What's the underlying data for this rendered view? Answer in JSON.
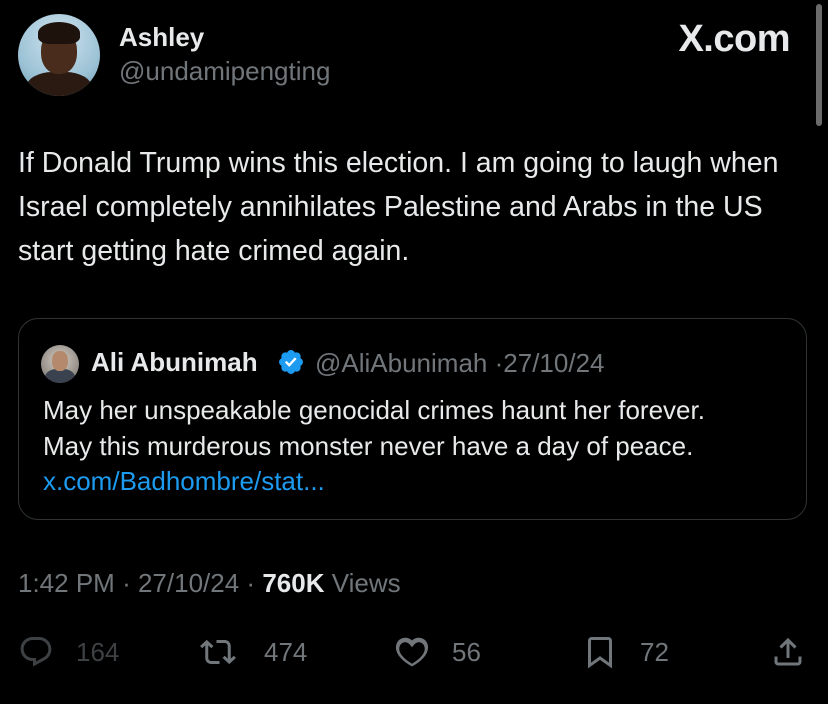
{
  "author": {
    "name": "Ashley",
    "handle": "@undamipengting"
  },
  "brand": "X.com",
  "tweet": {
    "text": "If Donald Trump wins this election. I am going to laugh when Israel completely annihilates Palestine and Arabs in the US start getting hate crimed again."
  },
  "quote": {
    "name": "Ali Abunimah",
    "handle": "@AliAbunimah",
    "date": "27/10/24",
    "line1": "May her unspeakable genocidal crimes haunt her forever.",
    "line2": "May this murderous monster never have a day of peace.",
    "link": "x.com/Badhombre/stat..."
  },
  "meta": {
    "time": "1:42 PM",
    "date": "27/10/24",
    "views_count": "760K",
    "views_label": "Views"
  },
  "actions": {
    "replies": "164",
    "reposts": "474",
    "likes": "56",
    "bookmarks": "72"
  },
  "colors": {
    "background": "#000000",
    "text": "#e7e9ea",
    "secondary": "#71767b",
    "link": "#1d9bf0",
    "verified": "#1d9bf0",
    "border": "#2f3336"
  }
}
